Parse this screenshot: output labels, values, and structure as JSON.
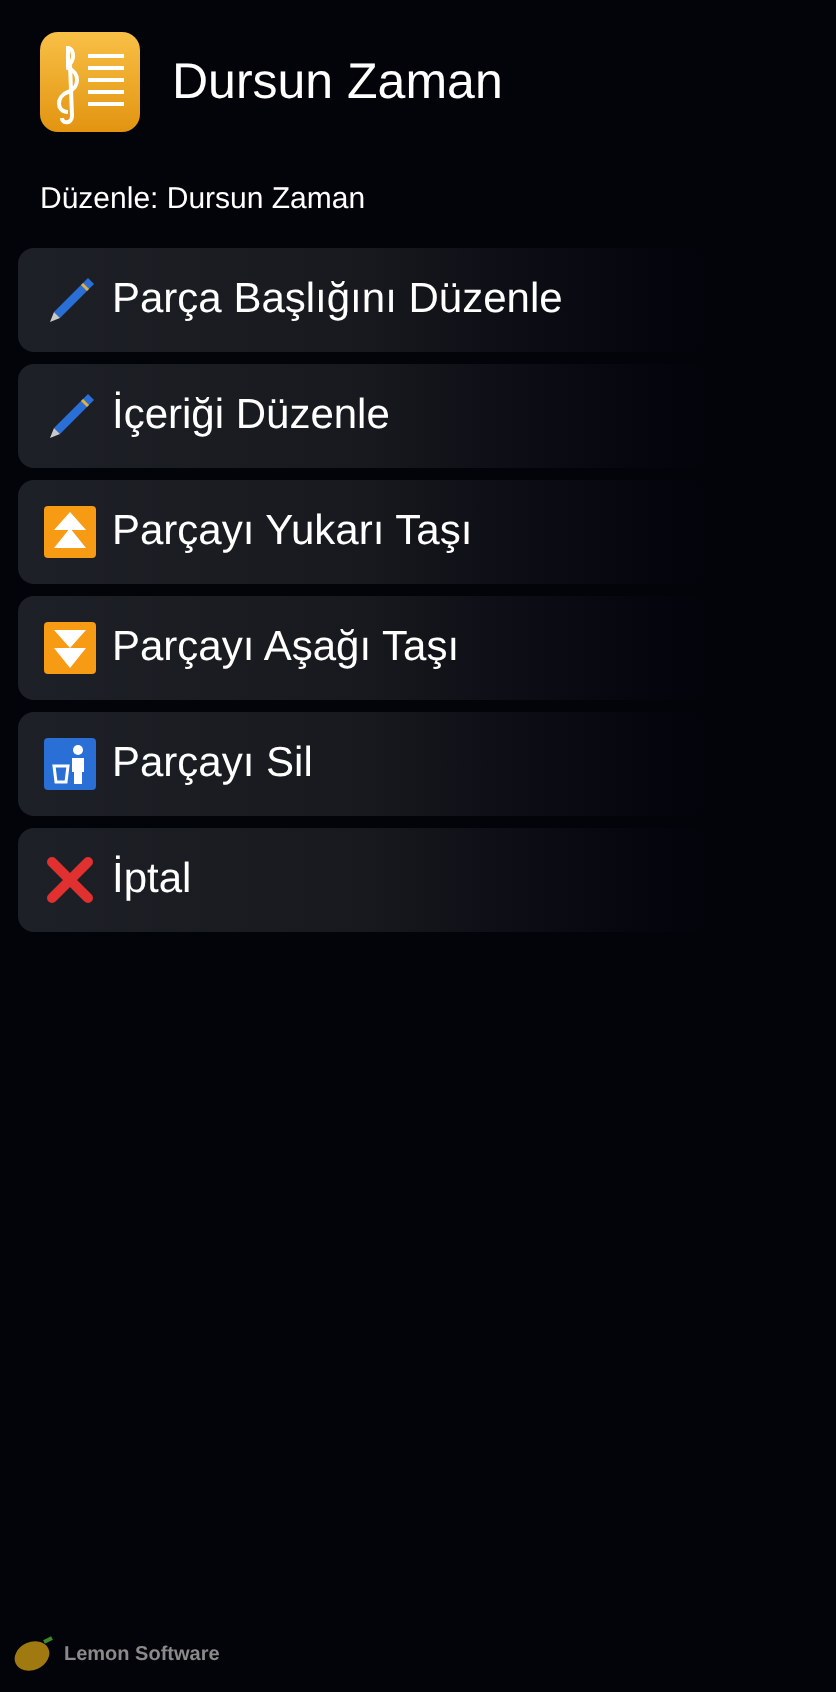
{
  "header": {
    "title": "Dursun Zaman"
  },
  "subtitle": "Düzenle: Dursun Zaman",
  "menu": [
    {
      "kind": "pencil",
      "label": "Parça Başlığını Düzenle"
    },
    {
      "kind": "pencil",
      "label": "İçeriği Düzenle"
    },
    {
      "kind": "up",
      "label": "Parçayı Yukarı Taşı"
    },
    {
      "kind": "down",
      "label": "Parçayı Aşağı Taşı"
    },
    {
      "kind": "trash",
      "label": "Parçayı Sil"
    },
    {
      "kind": "cancel",
      "label": "İptal"
    }
  ],
  "footer": {
    "brand": "Lemon Software"
  }
}
